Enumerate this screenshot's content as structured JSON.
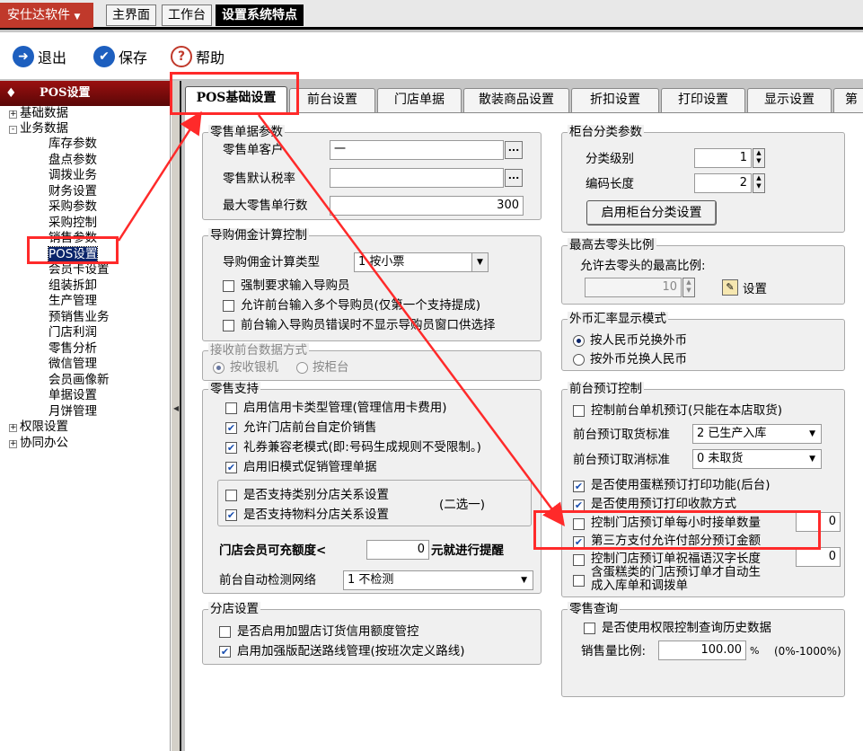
{
  "app": {
    "menu_label": "安仕达软件"
  },
  "top_tabs": [
    {
      "label": "主界面",
      "active": false
    },
    {
      "label": "工作台",
      "active": false
    },
    {
      "label": "设置系统特点",
      "active": true
    }
  ],
  "toolbar": {
    "exit_label": "退出",
    "save_label": "保存",
    "help_label": "帮助"
  },
  "sidebar": {
    "title": "POS设置",
    "tree": [
      {
        "label": "基础数据",
        "level": 0,
        "expander": "+"
      },
      {
        "label": "业务数据",
        "level": 0,
        "expander": "-"
      },
      {
        "label": "库存参数",
        "level": 1
      },
      {
        "label": "盘点参数",
        "level": 1
      },
      {
        "label": "调拨业务",
        "level": 1
      },
      {
        "label": "财务设置",
        "level": 1
      },
      {
        "label": "采购参数",
        "level": 1
      },
      {
        "label": "采购控制",
        "level": 1
      },
      {
        "label": "销售参数",
        "level": 1
      },
      {
        "label": "POS设置",
        "level": 1,
        "selected": true
      },
      {
        "label": "会员卡设置",
        "level": 1
      },
      {
        "label": "组装拆卸",
        "level": 1
      },
      {
        "label": "生产管理",
        "level": 1
      },
      {
        "label": "预销售业务",
        "level": 1
      },
      {
        "label": "门店利润",
        "level": 1
      },
      {
        "label": "零售分析",
        "level": 1
      },
      {
        "label": "微信管理",
        "level": 1
      },
      {
        "label": "会员画像新",
        "level": 1
      },
      {
        "label": "单据设置",
        "level": 1
      },
      {
        "label": "月饼管理",
        "level": 1
      },
      {
        "label": "权限设置",
        "level": 0,
        "expander": "+"
      },
      {
        "label": "协同办公",
        "level": 0,
        "expander": "+"
      }
    ]
  },
  "content_tabs": [
    {
      "label": "POS基础设置",
      "active": true
    },
    {
      "label": "前台设置"
    },
    {
      "label": "门店单据"
    },
    {
      "label": "散装商品设置"
    },
    {
      "label": "折扣设置"
    },
    {
      "label": "打印设置"
    },
    {
      "label": "显示设置"
    },
    {
      "label": "第"
    }
  ],
  "retail_doc": {
    "title": "零售单据参数",
    "customer_label": "零售单客户",
    "customer_value": "一",
    "tax_label": "零售默认税率",
    "tax_value": "",
    "maxrows_label": "最大零售单行数",
    "maxrows_value": "300",
    "dots": "..."
  },
  "guide": {
    "title": "导购佣金计算控制",
    "type_label": "导购佣金计算类型",
    "type_value": "1 按小票",
    "opt1": {
      "label": "强制要求输入导购员",
      "checked": false
    },
    "opt2": {
      "label": "允许前台输入多个导购员(仅第一个支持提成)",
      "checked": false
    },
    "opt3": {
      "label": "前台输入导购员错误时不显示导购员窗口供选择",
      "checked": false
    }
  },
  "receive": {
    "title": "接收前台数据方式",
    "opt_a": "按收银机",
    "opt_b": "按柜台"
  },
  "retail_support": {
    "title": "零售支持",
    "opt1": {
      "label": "启用信用卡类型管理(管理信用卡费用)",
      "checked": false
    },
    "opt2": {
      "label": "允许门店前台自定价销售",
      "checked": true
    },
    "opt3": {
      "label": "礼券兼容老模式(即:号码生成规则不受限制。)",
      "checked": true
    },
    "opt4": {
      "label": "启用旧模式促销管理单据",
      "checked": true
    },
    "sub1": {
      "label": "是否支持类别分店关系设置",
      "checked": false
    },
    "sub2": {
      "label": "是否支持物料分店关系设置",
      "checked": true
    },
    "choose_one": "(二选一)",
    "member_prefix": "门店会员可充额度<",
    "member_value": "0",
    "member_suffix": "元就进行提醒",
    "network_label": "前台自动检测网络",
    "network_value": "1 不检测"
  },
  "branch": {
    "title": "分店设置",
    "opt1": {
      "label": "是否启用加盟店订货信用额度管控",
      "checked": false
    },
    "opt2": {
      "label": "启用加强版配送路线管理(按班次定义路线)",
      "checked": true
    }
  },
  "counter": {
    "title": "柜台分类参数",
    "level_label": "分类级别",
    "level_value": "1",
    "code_label": "编码长度",
    "code_value": "2",
    "button": "启用柜台分类设置"
  },
  "rounding": {
    "title": "最高去零头比例",
    "allow_label": "允许去零头的最高比例:",
    "value": "10",
    "setting_label": "设置"
  },
  "fx": {
    "title": "外币汇率显示模式",
    "opt_a": "按人民币兑换外币",
    "opt_b": "按外币兑换人民币"
  },
  "preorder": {
    "title": "前台预订控制",
    "opt1": {
      "label": "控制前台单机预订(只能在本店取货)",
      "checked": false
    },
    "pickup_label": "前台预订取货标准",
    "pickup_value": "2 已生产入库",
    "cancel_label": "前台预订取消标准",
    "cancel_value": "0 未取货",
    "opt2": {
      "label": "是否使用蛋糕预订打印功能(后台)",
      "checked": true
    },
    "opt3": {
      "label": "是否使用预订打印收款方式",
      "checked": true
    },
    "opt4": {
      "label": "控制门店预订单每小时接单数量",
      "checked": false,
      "value": "0"
    },
    "opt5": {
      "label": "第三方支付允许付部分预订金额",
      "checked": true
    },
    "opt6": {
      "label": "控制门店预订单祝福语汉字长度",
      "checked": false,
      "value": "0"
    },
    "opt7": {
      "label_line1": "含蛋糕类的门店预订单才自动生",
      "label_line2": "成入库单和调拨单",
      "checked": false
    }
  },
  "sales_query": {
    "title": "零售查询",
    "opt1": {
      "label": "是否使用权限控制查询历史数据",
      "checked": false
    },
    "ratio_label": "销售量比例:",
    "ratio_value": "100.00",
    "ratio_unit": "%",
    "ratio_range": "(0%-1000%)"
  },
  "colors": {
    "annotation_red": "#ff2a2a",
    "selection_blue": "#0a246a",
    "brand_red": "#c0392b"
  }
}
